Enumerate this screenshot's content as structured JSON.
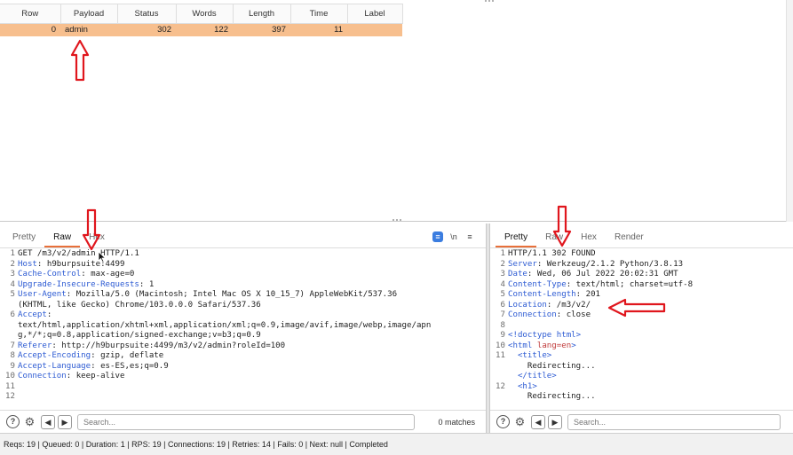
{
  "results": {
    "columns": [
      "Row",
      "Payload",
      "Status",
      "Words",
      "Length",
      "Time",
      "Label"
    ],
    "rows": [
      {
        "row": "0",
        "payload": "admin",
        "status": "302",
        "words": "122",
        "length": "397",
        "time": "11",
        "label": ""
      }
    ]
  },
  "request": {
    "tabs": [
      "Pretty",
      "Raw",
      "Hex"
    ],
    "active_tab": "Raw",
    "view_icons": [
      "prettify-icon",
      "\\n",
      "≡"
    ],
    "lines": [
      {
        "n": "1",
        "text": "GET /m3/v2/admin HTTP/1.1"
      },
      {
        "n": "2",
        "key": "Host",
        "value": " h9burpsuite:4499"
      },
      {
        "n": "3",
        "key": "Cache-Control",
        "value": " max-age=0"
      },
      {
        "n": "4",
        "key": "Upgrade-Insecure-Requests",
        "value": " 1"
      },
      {
        "n": "5",
        "key": "User-Agent",
        "value": " Mozilla/5.0 (Macintosh; Intel Mac OS X 10_15_7) AppleWebKit/537.36\n(KHTML, like Gecko) Chrome/103.0.0.0 Safari/537.36"
      },
      {
        "n": "6",
        "key": "Accept",
        "value": "\ntext/html,application/xhtml+xml,application/xml;q=0.9,image/avif,image/webp,image/apn\ng,*/*;q=0.8,application/signed-exchange;v=b3;q=0.9"
      },
      {
        "n": "7",
        "key": "Referer",
        "value": " http://h9burpsuite:4499/m3/v2/admin?roleId=100"
      },
      {
        "n": "8",
        "key": "Accept-Encoding",
        "value": " gzip, deflate"
      },
      {
        "n": "9",
        "key": "Accept-Language",
        "value": " es-ES,es;q=0.9"
      },
      {
        "n": "10",
        "key": "Connection",
        "value": " keep-alive"
      },
      {
        "n": "11",
        "text": ""
      },
      {
        "n": "12",
        "text": ""
      }
    ],
    "search_placeholder": "Search...",
    "matches": "0 matches"
  },
  "response": {
    "tabs": [
      "Pretty",
      "Raw",
      "Hex",
      "Render"
    ],
    "active_tab": "Pretty",
    "lines": [
      {
        "n": "1",
        "text": "HTTP/1.1 302 FOUND"
      },
      {
        "n": "2",
        "key": "Server",
        "value": " Werkzeug/2.1.2 Python/3.8.13"
      },
      {
        "n": "3",
        "key": "Date",
        "value": " Wed, 06 Jul 2022 20:02:31 GMT"
      },
      {
        "n": "4",
        "key": "Content-Type",
        "value": " text/html; charset=utf-8"
      },
      {
        "n": "5",
        "key": "Content-Length",
        "value": " 201"
      },
      {
        "n": "6",
        "key": "Location",
        "value": " /m3/v2/"
      },
      {
        "n": "7",
        "key": "Connection",
        "value": " close"
      },
      {
        "n": "8",
        "text": ""
      },
      {
        "n": "9",
        "html": [
          [
            "t",
            "<!doctype html>"
          ]
        ]
      },
      {
        "n": "10",
        "html": [
          [
            "t",
            "<html "
          ],
          [
            "a",
            "lang=en"
          ],
          [
            "t",
            ">"
          ]
        ]
      },
      {
        "n": "11",
        "html": [
          [
            "p",
            "  "
          ],
          [
            "t",
            "<title>"
          ]
        ]
      },
      {
        "n": "",
        "html": [
          [
            "p",
            "    Redirecting..."
          ]
        ]
      },
      {
        "n": "",
        "html": [
          [
            "p",
            "  "
          ],
          [
            "t",
            "</title>"
          ]
        ]
      },
      {
        "n": "12",
        "html": [
          [
            "p",
            "  "
          ],
          [
            "t",
            "<h1>"
          ]
        ]
      },
      {
        "n": "",
        "html": [
          [
            "p",
            "    Redirecting..."
          ]
        ]
      }
    ],
    "search_placeholder": "Search..."
  },
  "statusbar": {
    "text": "Reqs: 19 | Queued: 0 | Duration: 1 | RPS: 19 | Connections: 19 | Retries: 14 | Fails: 0 | Next: null | Completed"
  },
  "annotation_color": "#e0161d",
  "selection_color": "#f7bf8e",
  "accent_tab_color": "#e8703a"
}
